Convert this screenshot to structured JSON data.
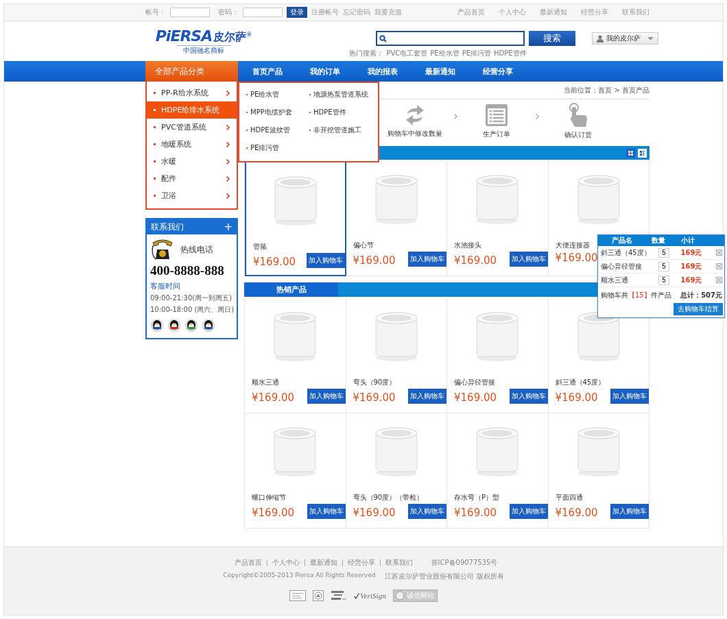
{
  "top_bar": {
    "account_label": "帐号：",
    "password_label": "密码：",
    "login_button": "登录",
    "links": [
      "注册帐号",
      "忘记密码",
      "我要充值"
    ],
    "right_links": [
      "产品首页",
      "个人中心",
      "最新通知",
      "经营分享",
      "联系我们"
    ]
  },
  "header": {
    "logo": {
      "brand": "PiERSA",
      "name": "皮尔萨$^{®}$",
      "tagline": "中国驰名商标"
    },
    "search": {
      "button": "搜索",
      "hot_label": "热门搜索：",
      "hot_terms": [
        "PVC电工套管",
        "PE给水管",
        "PE排污管",
        "HDPE管件"
      ]
    },
    "user_menu": "我的皮尔萨"
  },
  "nav": {
    "category_title": "全部产品分类",
    "items": [
      "首页产品",
      "我的订单",
      "我的报表",
      "最新通知",
      "经营分享"
    ]
  },
  "categories": [
    {
      "label": "PP-R给水系统",
      "selected": false
    },
    {
      "label": "HDPE给排水系统",
      "selected": true
    },
    {
      "label": "PVC管道系统",
      "selected": false
    },
    {
      "label": "地暖系统",
      "selected": false
    },
    {
      "label": "水暖",
      "selected": false
    },
    {
      "label": "配件",
      "selected": false
    },
    {
      "label": "卫浴",
      "selected": false
    }
  ],
  "submenu": [
    "PE给水管",
    "地源热泵管道系统",
    "MPP电缆护套",
    "HDPE管件",
    "HDPE波纹管",
    "非开挖管道施工",
    "PE排污管"
  ],
  "contact": {
    "title": "联系我们",
    "toggle": "+",
    "hotline_label": "热线电话",
    "phone": "400-8888-888",
    "hours_title": "客服时间",
    "hours": [
      "09:00-21:30(周一到周五)",
      "10:00-18:00 (周六、周日)"
    ],
    "qq_icons": [
      {
        "color": "#1f4fa8"
      },
      {
        "color": "#d4281c"
      },
      {
        "color": "#2a9a3a"
      },
      {
        "color": "#1f4fa8"
      }
    ]
  },
  "breadcrumb": "当前位置：首页 > 首页产品",
  "steps": [
    {
      "kind": "refresh",
      "label": "购物车中修改数量"
    },
    {
      "kind": "order",
      "label": "生产订单"
    },
    {
      "kind": "tap",
      "label": "确认订货"
    }
  ],
  "view_toggle": [
    {
      "kind": "grid",
      "selected": true
    },
    {
      "kind": "list",
      "selected": false
    }
  ],
  "products": [
    {
      "name": "管箍",
      "price": "¥169.00",
      "button": "加入购物车",
      "selected": true
    },
    {
      "name": "偏心节",
      "price": "¥169.00",
      "button": "加入购物车",
      "selected": false
    },
    {
      "name": "水池接头",
      "price": "¥169.00",
      "button": "加入购物车",
      "selected": false
    },
    {
      "name": "大便连接器",
      "price": "¥169.00",
      "selected": false
    }
  ],
  "hot_section": {
    "title": "热销产品",
    "products": [
      {
        "name": "顺水三通",
        "price": "¥169.00",
        "button": "加入购物车",
        "selected": false
      },
      {
        "name": "弯头（90度）",
        "price": "¥169.00",
        "button": "加入购物车",
        "selected": false
      },
      {
        "name": "偏心异径管接",
        "price": "¥169.00",
        "button": "加入购物车",
        "selected": false
      },
      {
        "name": "斜三通（45度）",
        "price": "¥169.00",
        "button": "加入购物车",
        "selected": false
      },
      {
        "name": "螺口伸缩节",
        "price": "¥169.00",
        "button": "加入购物车",
        "selected": false
      },
      {
        "name": "弯头（90度）（带检）",
        "price": "¥169.00",
        "button": "加入购物车",
        "selected": false
      },
      {
        "name": "存水弯（P）型",
        "price": "¥169.00",
        "button": "加入购物车",
        "selected": false
      },
      {
        "name": "平面四通",
        "price": "¥169.00",
        "button": "加入购物车",
        "selected": false
      }
    ]
  },
  "cart": {
    "columns": [
      "产品名",
      "数量",
      "小计"
    ],
    "rows": [
      {
        "name": "斜三通（45度）",
        "qty": "5",
        "subtotal": "169元"
      },
      {
        "name": "偏心异径管接",
        "qty": "5",
        "subtotal": "169元"
      },
      {
        "name": "顺水三通",
        "qty": "5",
        "subtotal": "169元"
      }
    ],
    "summary_prefix": "购物车共",
    "count": "【15】",
    "summary_suffix": "件产品",
    "total": "总计：507元",
    "checkout": "去购物车结算"
  },
  "footer": {
    "links": [
      "产品首页",
      "个人中心",
      "最新通知",
      "经营分享",
      "联系我们"
    ],
    "icp": "苏ICP备09077535号",
    "copyright": "Copyright©2005-2013 Piersa All Rights Reserved",
    "company": "江苏皮尔萨管业股份有限公司 版权所有",
    "badges": [
      {
        "kind": "seal"
      },
      {
        "kind": "shield"
      },
      {
        "kind": "visa"
      },
      {
        "kind": "verisign",
        "text": "VeriSign"
      },
      {
        "kind": "trust",
        "text": "诚信网站"
      }
    ]
  }
}
